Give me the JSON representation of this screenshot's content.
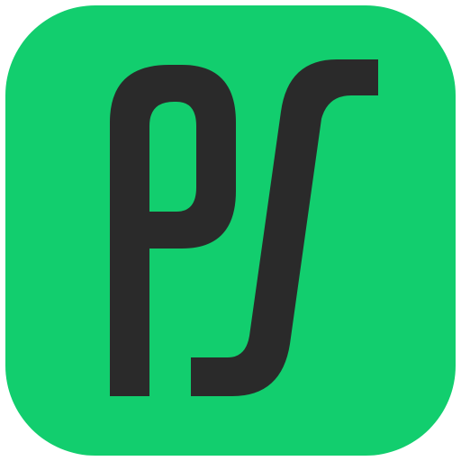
{
  "icon": {
    "name": "ps-app-icon",
    "logo_text": "ps",
    "background_color": "#12CE6E",
    "glyph_color": "#2A2A2A"
  }
}
